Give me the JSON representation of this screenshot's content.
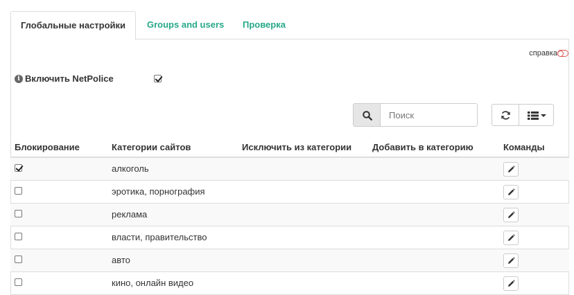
{
  "tabs": [
    {
      "label": "Глобальные настройки",
      "active": true
    },
    {
      "label": "Groups and users",
      "active": false
    },
    {
      "label": "Проверка",
      "active": false
    }
  ],
  "help": {
    "label": "справка",
    "icon": "toggle-icon"
  },
  "netpolice": {
    "label": "Включить NetPolice",
    "enabled": true,
    "icon": "info-icon"
  },
  "toolbar": {
    "search_placeholder": "Поиск",
    "search_icon": "search-icon",
    "refresh_icon": "refresh-icon",
    "columns_icon": "columns-icon"
  },
  "table": {
    "headers": [
      "Блокирование",
      "Категории сайтов",
      "Исключить из категории",
      "Добавить в категорию",
      "Команды"
    ],
    "rows": [
      {
        "blocked": true,
        "category": "алкоголь"
      },
      {
        "blocked": false,
        "category": "эротика, порнография"
      },
      {
        "blocked": false,
        "category": "реклама"
      },
      {
        "blocked": false,
        "category": "власти, правительство"
      },
      {
        "blocked": false,
        "category": "авто"
      },
      {
        "blocked": false,
        "category": "кино, онлайн видео"
      }
    ]
  },
  "colors": {
    "tab_link": "#26a88a",
    "help_toggle": "#d9534f",
    "row_stripe": "#f9f9f9",
    "border": "#dddddd"
  }
}
